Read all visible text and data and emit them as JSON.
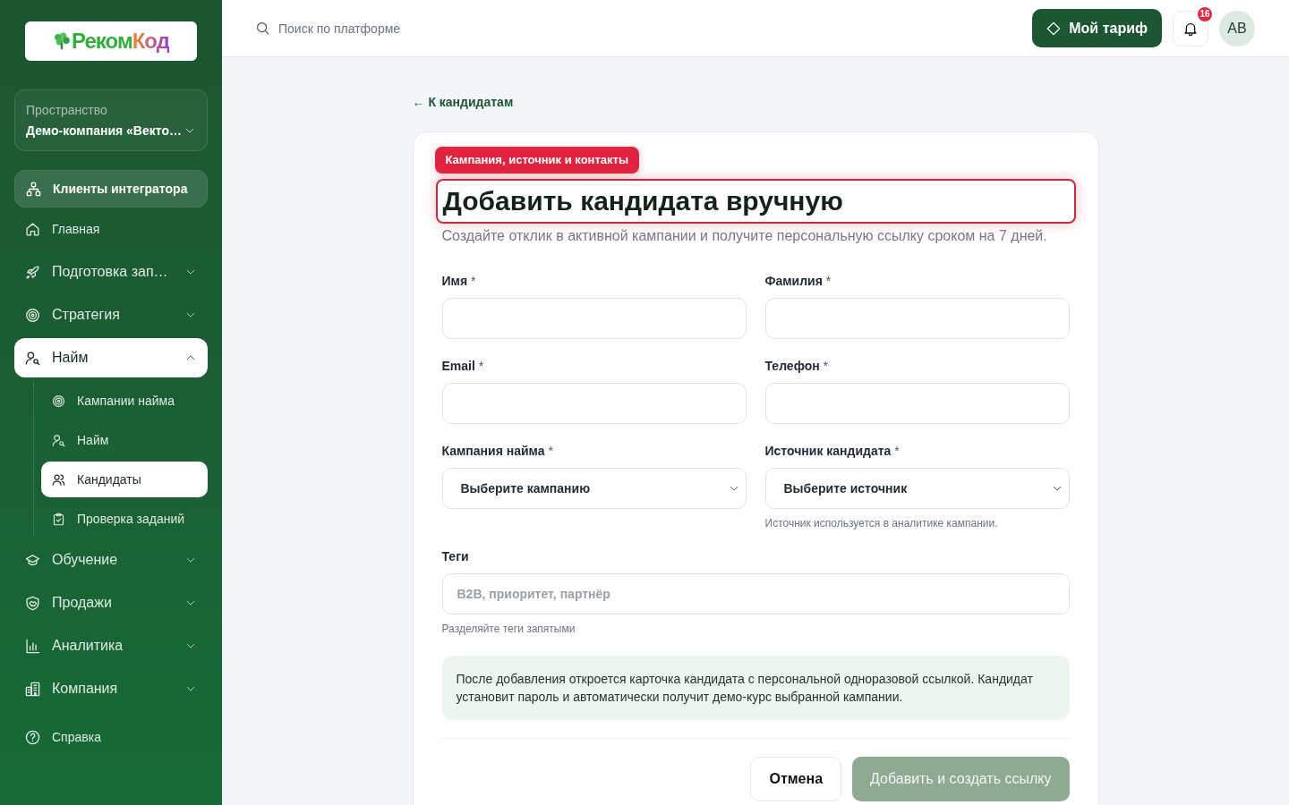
{
  "sidebar": {
    "logo": {
      "parts": [
        "Реком",
        "Код"
      ]
    },
    "workspace": {
      "label": "Пространство",
      "value": "Демо-компания «Векто…"
    },
    "integrator_button": {
      "label": "Клиенты интегратора"
    },
    "nav": [
      {
        "kind": "link",
        "label": "Главная",
        "selected": false
      },
      {
        "kind": "group",
        "label": "Подготовка зап…",
        "expanded": false,
        "selected": false
      },
      {
        "kind": "group",
        "label": "Стратегия",
        "expanded": false,
        "selected": false
      },
      {
        "kind": "group",
        "label": "Найм",
        "expanded": true,
        "selected": true,
        "children": [
          {
            "label": "Кампании найма",
            "selected": false
          },
          {
            "label": "Найм",
            "selected": false
          },
          {
            "label": "Кандидаты",
            "selected": true
          },
          {
            "label": "Проверка заданий",
            "selected": false
          }
        ]
      },
      {
        "kind": "group",
        "label": "Обучение",
        "expanded": false,
        "selected": false
      },
      {
        "kind": "group",
        "label": "Продажи",
        "expanded": false,
        "selected": false
      },
      {
        "kind": "group",
        "label": "Аналитика",
        "expanded": false,
        "selected": false
      },
      {
        "kind": "group",
        "label": "Компания",
        "expanded": false,
        "selected": false
      },
      {
        "kind": "link",
        "label": "Справка",
        "selected": false
      }
    ]
  },
  "topbar": {
    "search": {
      "placeholder": "Поиск по платформе"
    },
    "plan_button": "Мой тариф",
    "notifications": {
      "count": "16"
    },
    "avatar": "АВ"
  },
  "page": {
    "back_link": "← К кандидатам",
    "tour_badge": "Кампания, источник и контакты",
    "title": {
      "text": "Добавить кандидата вручную",
      "highlighted": true
    },
    "subtitle": "Создайте отклик в активной кампании и получите персональную ссылку сроком на 7 дней.",
    "fields": [
      {
        "kind": "text",
        "label": "Имя",
        "mark": "*"
      },
      {
        "kind": "text",
        "label": "Фамилия",
        "mark": "*"
      },
      {
        "kind": "text",
        "label": "Email",
        "mark": "*"
      },
      {
        "kind": "text",
        "label": "Телефон",
        "mark": "*"
      },
      {
        "kind": "select",
        "label": "Кампания найма",
        "mark": "*",
        "value": "Выберите кампанию"
      },
      {
        "kind": "select",
        "label": "Источник кандидата",
        "mark": "*",
        "value": "Выберите источник",
        "hint": "Источник используется в аналитике кампании."
      },
      {
        "kind": "tags",
        "label": "Теги",
        "placeholder": "B2B, приоритет, партнёр",
        "hint": "Разделяйте теги запятыми"
      }
    ],
    "notice": "После добавления откроется карточка кандидата с персональной одноразовой ссылкой. Кандидат установит пароль и автоматически получит демо-курс выбранной кампании.",
    "actions": [
      {
        "kind": "secondary",
        "label": "Отмена",
        "disabled": false
      },
      {
        "kind": "primary",
        "label": "Добавить и создать ссылку",
        "disabled": true
      }
    ]
  }
}
